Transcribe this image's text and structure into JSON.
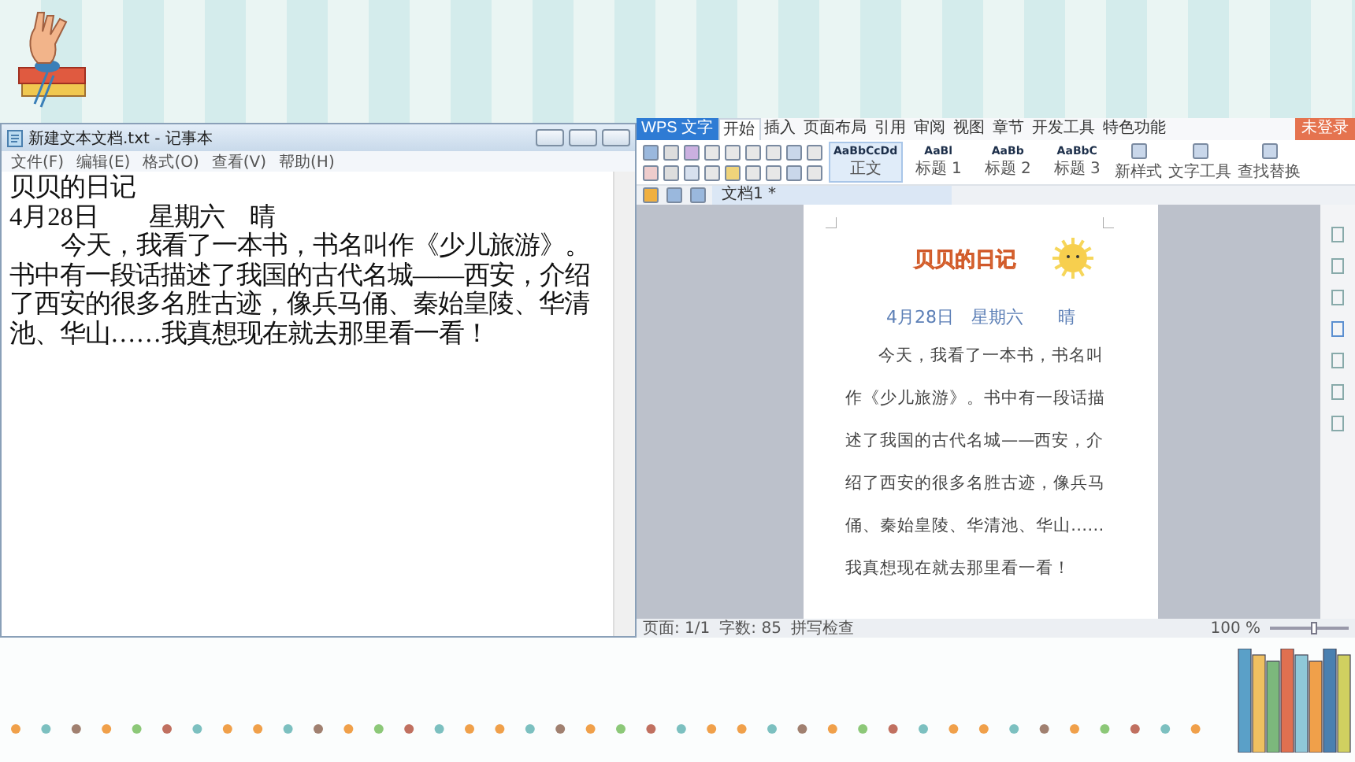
{
  "notepad": {
    "title": "新建文本文档.txt - 记事本",
    "menu": [
      "文件(F)",
      "编辑(E)",
      "格式(O)",
      "查看(V)",
      "帮助(H)"
    ],
    "lines": [
      "贝贝的日记",
      "4月28日　　星期六　晴"
    ],
    "paragraph": "今天，我看了一本书，书名叫作《少儿旅游》。书中有一段话描述了我国的古代名城——西安，介绍了西安的很多名胜古迹，像兵马俑、秦始皇陵、华清池、华山……我真想现在就去那里看一看！"
  },
  "wps": {
    "app_button": "WPS 文字",
    "tabs": [
      {
        "label": "开始",
        "selected": true
      },
      {
        "label": "插入",
        "selected": false
      },
      {
        "label": "页面布局",
        "selected": false
      },
      {
        "label": "引用",
        "selected": false
      },
      {
        "label": "审阅",
        "selected": false
      },
      {
        "label": "视图",
        "selected": false
      },
      {
        "label": "章节",
        "selected": false
      },
      {
        "label": "开发工具",
        "selected": false
      },
      {
        "label": "特色功能",
        "selected": false
      }
    ],
    "login": "未登录",
    "styles": [
      {
        "sample": "AaBbCcDd",
        "label": "正文",
        "selected": true
      },
      {
        "sample": "AaBl",
        "label": "标题 1",
        "selected": false
      },
      {
        "sample": "AaBb",
        "label": "标题 2",
        "selected": false
      },
      {
        "sample": "AaBbC",
        "label": "标题 3",
        "selected": false
      }
    ],
    "tools": [
      "新样式",
      "文字工具",
      "查找替换"
    ],
    "doc_tab": "文档1 *",
    "page": {
      "title": "贝贝的日记",
      "date": "4月28日　星期六　　晴",
      "paragraph": "今天，我看了一本书，书名叫作《少儿旅游》。书中有一段话描述了我国的古代名城——西安，介绍了西安的很多名胜古迹，像兵马俑、秦始皇陵、华清池、华山……我真想现在就去那里看一看！"
    },
    "status": {
      "items": [
        "页面: 1/1",
        "字数: 85",
        "拼写检查"
      ],
      "zoom": "100 %",
      "zoom_slider": {
        "level": 0.55
      }
    }
  }
}
